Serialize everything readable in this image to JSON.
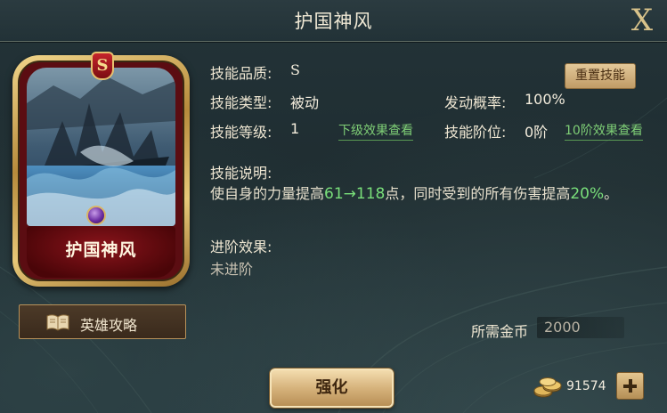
{
  "header": {
    "title": "护国神风",
    "close_label": "X"
  },
  "card": {
    "grade": "S",
    "name": "护国神风",
    "guide_button": "英雄攻略"
  },
  "skill": {
    "quality_label": "技能品质:",
    "quality_value": "S",
    "type_label": "技能类型:",
    "type_value": "被动",
    "trigger_label": "发动概率:",
    "trigger_value": "100%",
    "level_label": "技能等级:",
    "level_value": "1",
    "level_link": "下级效果查看",
    "rank_label": "技能阶位:",
    "rank_value": "0阶",
    "rank_link": "10阶效果查看",
    "reset_button": "重置技能",
    "desc_label": "技能说明:",
    "desc_part1": "使自身的力量提高",
    "desc_highlight1": "61→118",
    "desc_part2": "点，同时受到的所有伤害提高",
    "desc_highlight2": "20%",
    "desc_part3": "。",
    "advance_label": "进阶效果:",
    "advance_value": "未进阶"
  },
  "cost": {
    "label": "所需金币",
    "value": "2000"
  },
  "footer": {
    "strengthen_button": "强化",
    "gold_amount": "91574"
  },
  "colors": {
    "accent_green": "#79df7a",
    "gold": "#d8c28a",
    "card_red": "#5b0d12"
  },
  "icons": {
    "close": "close-icon",
    "book": "book-icon",
    "coins": "gold-coin-icon",
    "plus": "plus-icon"
  }
}
